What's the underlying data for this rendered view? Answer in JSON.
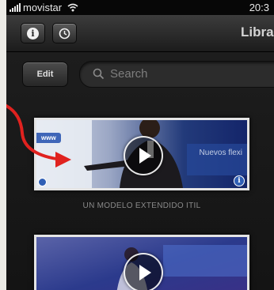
{
  "status_bar": {
    "carrier": "movistar",
    "time": "20:3"
  },
  "toolbar": {
    "title": "Libra"
  },
  "search": {
    "edit_label": "Edit",
    "placeholder": "Search"
  },
  "videos": [
    {
      "badge": "www",
      "overlay_text": "Nuevos flexi",
      "title": "UN MODELO EXTENDIDO ITIL"
    },
    {
      "title": ""
    }
  ],
  "colors": {
    "annotation": "#e0221f",
    "accent_badge": "#3f66b8"
  }
}
